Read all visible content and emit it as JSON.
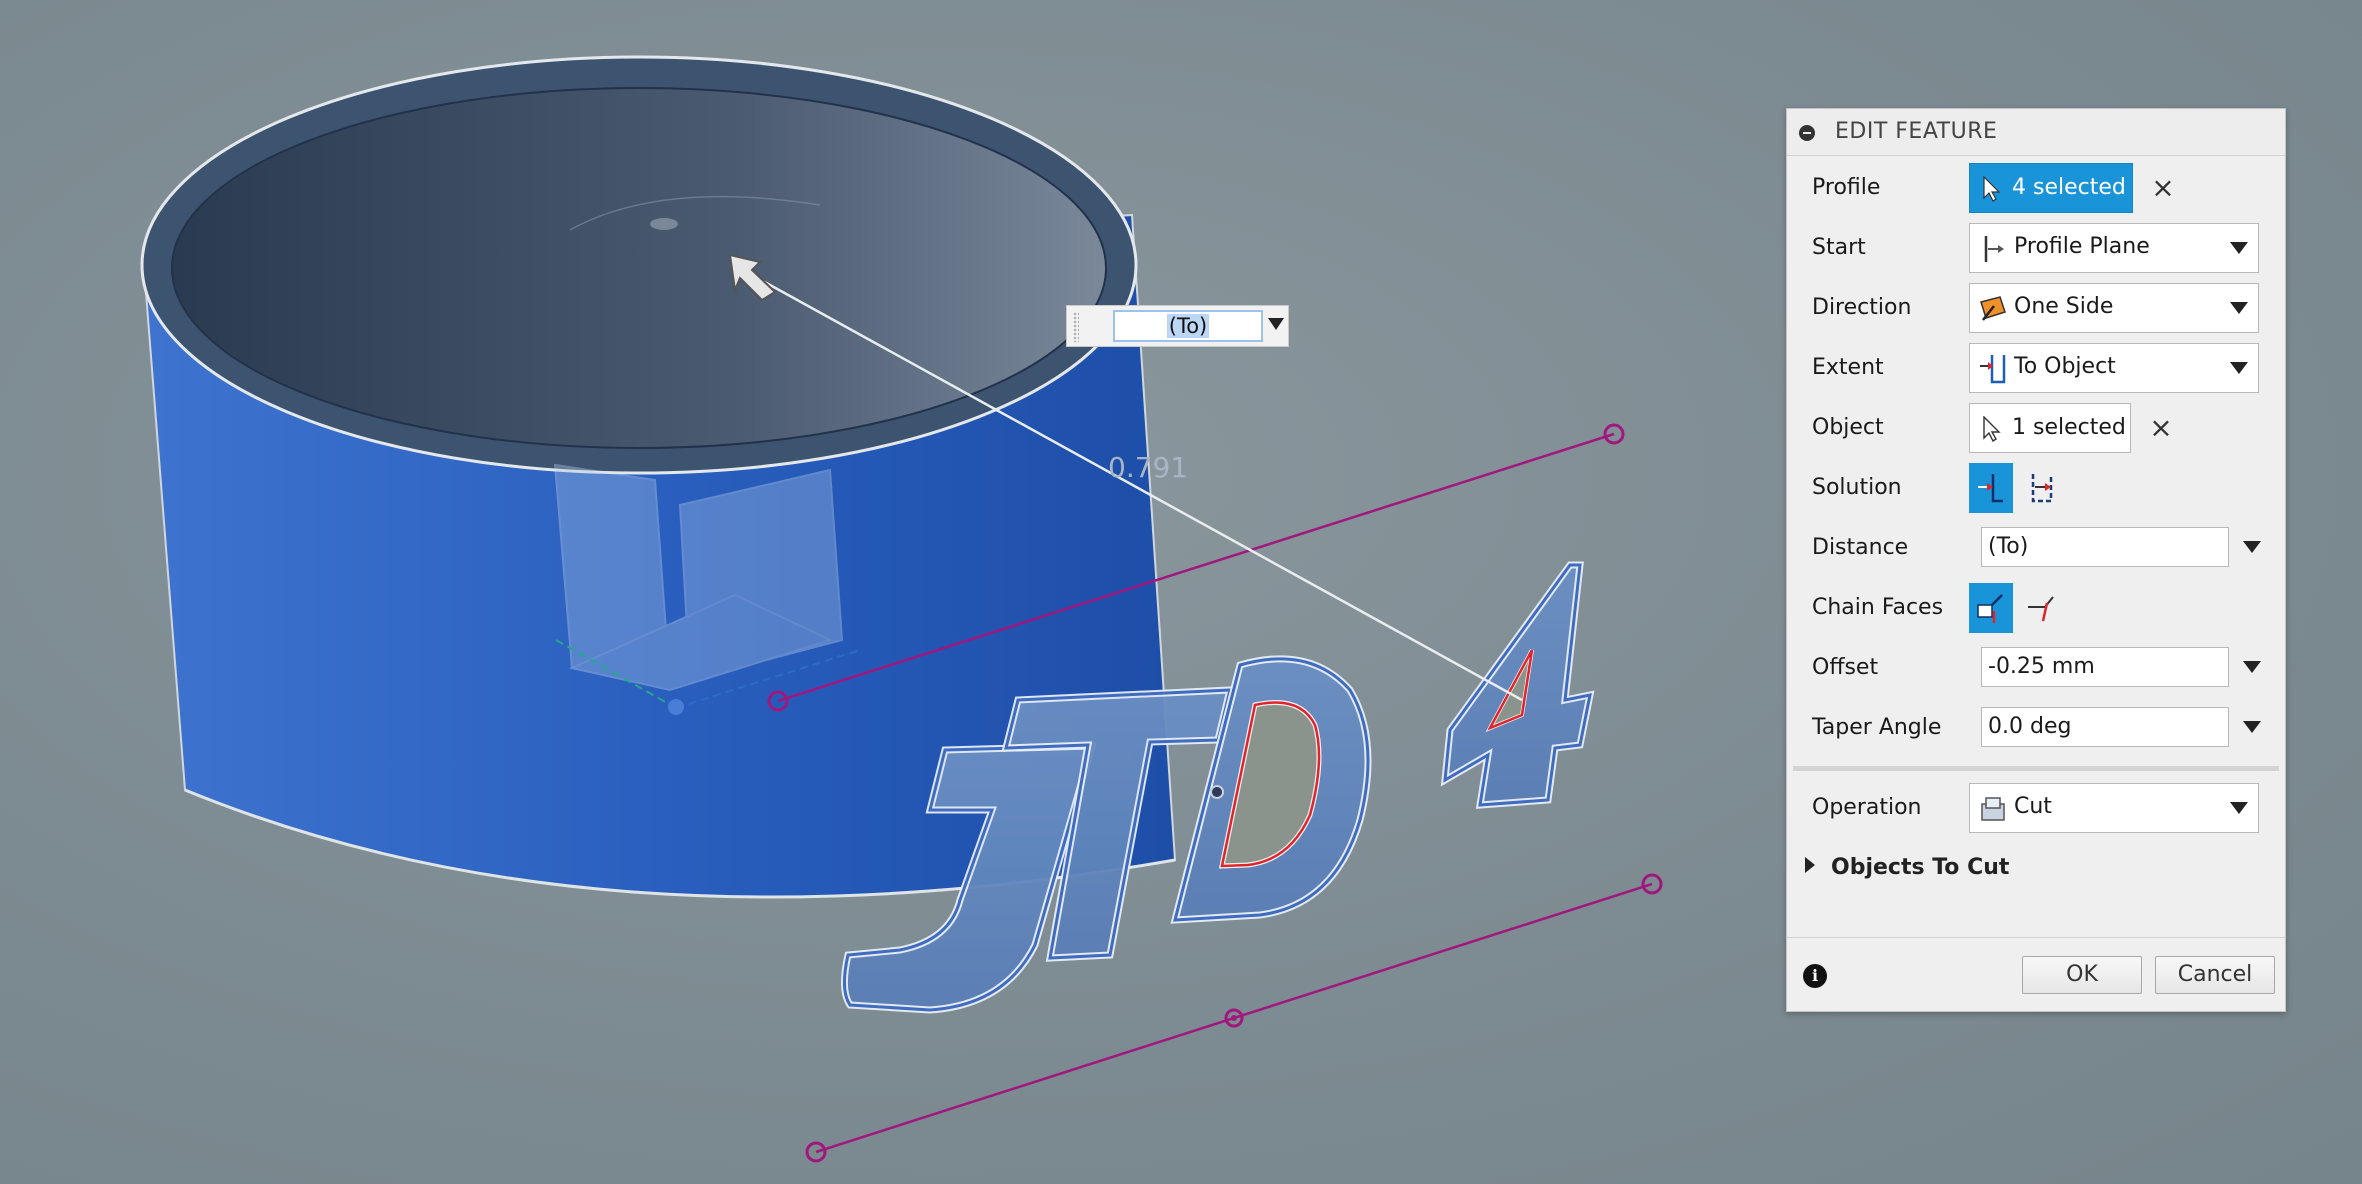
{
  "viewport": {
    "dimension_label": "0.791",
    "dimension_input_value": "(To)",
    "sketch_text": "JTD 4"
  },
  "panel": {
    "title": "EDIT FEATURE",
    "rows": {
      "profile": {
        "label": "Profile",
        "value": "4 selected"
      },
      "start": {
        "label": "Start",
        "value": "Profile Plane"
      },
      "direction": {
        "label": "Direction",
        "value": "One Side"
      },
      "extent": {
        "label": "Extent",
        "value": "To Object"
      },
      "object": {
        "label": "Object",
        "value": "1 selected"
      },
      "solution": {
        "label": "Solution"
      },
      "distance": {
        "label": "Distance",
        "value": "(To)"
      },
      "chain_faces": {
        "label": "Chain Faces"
      },
      "offset": {
        "label": "Offset",
        "value": "-0.25 mm"
      },
      "taper_angle": {
        "label": "Taper Angle",
        "value": "0.0 deg"
      },
      "operation": {
        "label": "Operation",
        "value": "Cut"
      }
    },
    "objects_to_cut": "Objects To Cut",
    "ok_label": "OK",
    "cancel_label": "Cancel"
  },
  "colors": {
    "accent": "#1a94d8",
    "body_blue": "#2f68c4",
    "sketch_line": "#a0177e",
    "profile_red": "#e0242c"
  }
}
